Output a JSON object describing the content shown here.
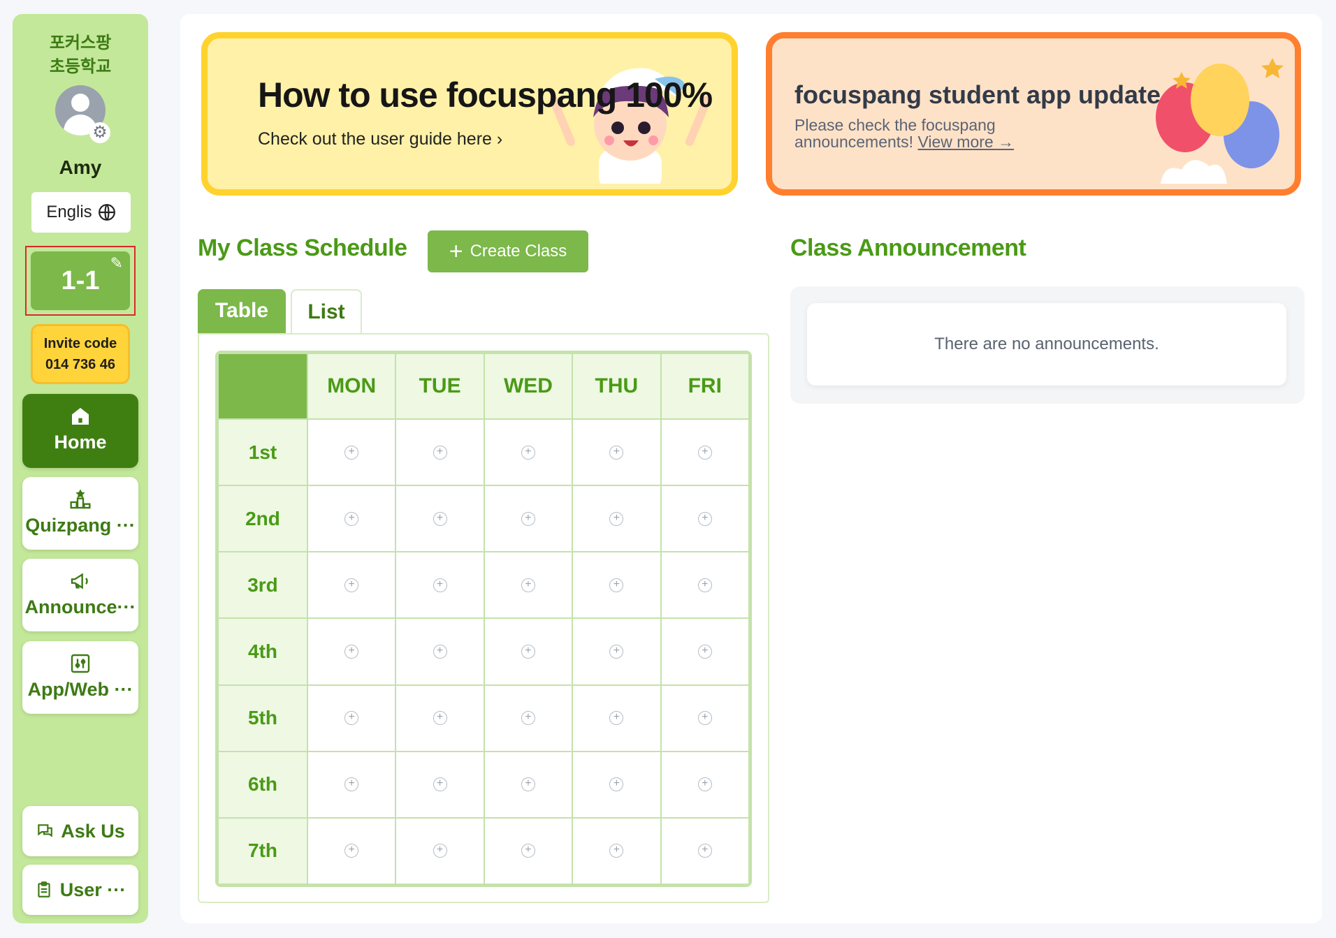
{
  "sidebar": {
    "school_line1": "포커스팡",
    "school_line2": "초등학교",
    "user_name": "Amy",
    "language": "Englis",
    "class_name": "1-1",
    "invite_label": "Invite code",
    "invite_code": "014 736 46",
    "nav": [
      {
        "label": "Home",
        "icon": "home-icon",
        "active": true
      },
      {
        "label": "Quizpang ···",
        "icon": "podium-icon"
      },
      {
        "label": "Announce···",
        "icon": "megaphone-icon"
      },
      {
        "label": "App/Web ···",
        "icon": "app-web-icon"
      }
    ],
    "ask_us": "Ask Us",
    "user_menu": "User ···"
  },
  "banners": {
    "guide_title": "How to use focuspang 100%",
    "guide_sub": "Check out the user guide here",
    "update_title": "focuspang student app update",
    "update_sub": "Please check the focuspang announcements!",
    "update_link": "View more →"
  },
  "schedule": {
    "title": "My Class Schedule",
    "create_label": "Create Class",
    "tabs": [
      "Table",
      "List"
    ],
    "days": [
      "MON",
      "TUE",
      "WED",
      "THU",
      "FRI"
    ],
    "periods": [
      "1st",
      "2nd",
      "3rd",
      "4th",
      "5th",
      "6th",
      "7th"
    ]
  },
  "announcements": {
    "title": "Class Announcement",
    "empty": "There are no announcements."
  },
  "colors": {
    "brand_green": "#7cb84a",
    "dark_green": "#3f7f12",
    "title_green": "#4a9a16",
    "sidebar_bg": "#c3e89a",
    "invite_yellow": "#ffd43b",
    "banner_yellow_border": "#ffd22e",
    "banner_orange_border": "#ff7f2f"
  }
}
